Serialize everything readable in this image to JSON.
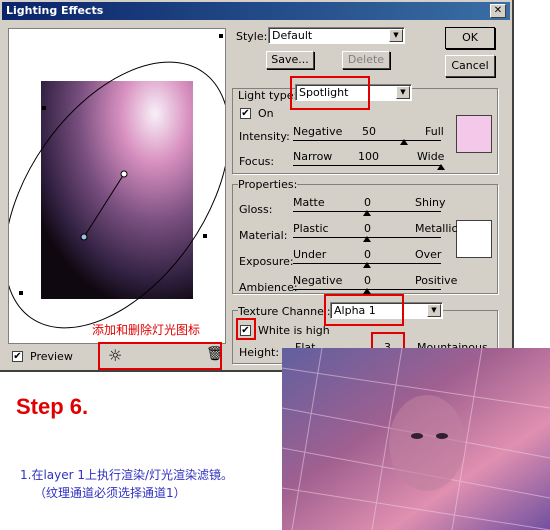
{
  "window": {
    "title": "Lighting Effects",
    "close_glyph": "✕"
  },
  "buttons": {
    "ok": "OK",
    "cancel": "Cancel",
    "save": "Save...",
    "delete": "Delete"
  },
  "style": {
    "label": "Style:",
    "value": "Default"
  },
  "light": {
    "type_label": "Light type:",
    "type_value": "Spotlight",
    "on_label": "On",
    "on_checked": "✔",
    "intensity": {
      "label": "Intensity:",
      "left": "Negative",
      "value": "50",
      "right": "Full",
      "level": 0.75
    },
    "focus": {
      "label": "Focus:",
      "left": "Narrow",
      "value": "100",
      "right": "Wide",
      "level": 1.0
    },
    "color": "#f4c8e8"
  },
  "properties": {
    "title": "Properties:",
    "rows": [
      {
        "label": "Gloss:",
        "left": "Matte",
        "value": "0",
        "right": "Shiny",
        "level": 0.5
      },
      {
        "label": "Material:",
        "left": "Plastic",
        "value": "0",
        "right": "Metallic",
        "level": 0.5
      },
      {
        "label": "Exposure:",
        "left": "Under",
        "value": "0",
        "right": "Over",
        "level": 0.5
      },
      {
        "label": "Ambience:",
        "left": "Negative",
        "value": "0",
        "right": "Positive",
        "level": 0.5
      }
    ],
    "color": "#ffffff"
  },
  "texture": {
    "channel_label": "Texture Channel:",
    "channel_value": "Alpha 1",
    "white_label": "White is high",
    "white_checked": "✔",
    "height_label": "Height:",
    "left": "Flat",
    "value": "3",
    "right": "Mountainous",
    "level": 0.03
  },
  "preview": {
    "label": "Preview",
    "checked": "✔",
    "bulb_glyph": "☼",
    "trash_glyph": "🗑"
  },
  "annotations": {
    "add_delete": "添加和删除灯光图标",
    "step": "Step 6.",
    "line1": "1.在layer 1上执行渲染/灯光渲染滤镜。",
    "line2": "（纹理通道必须选择通道1）"
  },
  "colors": {
    "accent_red": "#e00000",
    "note_blue": "#3030c0"
  }
}
